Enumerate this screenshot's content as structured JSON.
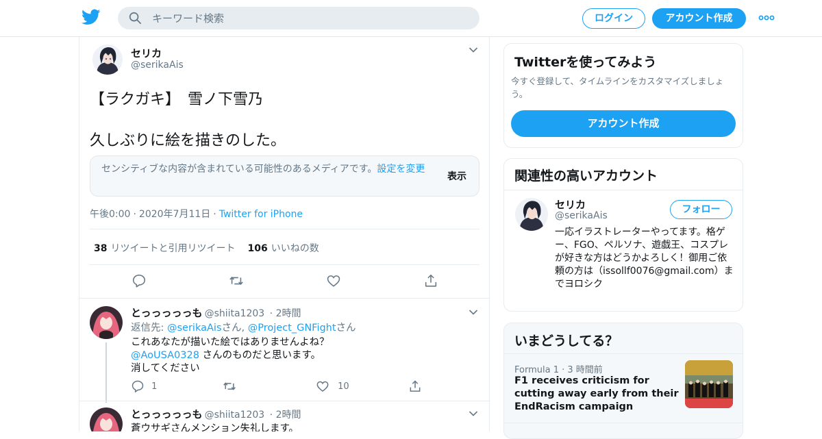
{
  "header": {
    "search_placeholder": "キーワード検索",
    "login_label": "ログイン",
    "signup_label": "アカウント作成",
    "brand_color": "#1da1f2"
  },
  "tweet": {
    "author_name": "セリカ",
    "author_handle": "@serikaAis",
    "text_line1": "【ラクガキ】　雪ノ下雪乃",
    "text_line2": "久しぶりに絵を描きのした。",
    "sensitive_message": "センシティブな内容が含まれている可能性のあるメディアです。",
    "sensitive_link": "設定を変更",
    "sensitive_show": "表示",
    "time": "午後0:00",
    "date": "2020年7月11日",
    "source": "Twitter for iPhone",
    "retweet_count": "38",
    "retweet_label": "リツイートと引用リツイート",
    "like_count": "106",
    "like_label": "いいねの数"
  },
  "replies": [
    {
      "name": "とっっっっっも",
      "handle": "@shiita1203",
      "time": "2時間",
      "reply_to_prefix": "返信先: ",
      "reply_to_1": "@serikaAis",
      "reply_to_sep": "さん, ",
      "reply_to_2": "@Project_GNFight",
      "reply_to_suffix": "さん",
      "line1": "これあなたが描いた絵ではありませんよね？",
      "mention": "@AoUSA0328",
      "line2_rest": " さんのものだと思います。",
      "line3": "消してください",
      "reply_count": "1",
      "like_count": "10"
    },
    {
      "name": "とっっっっっも",
      "handle": "@shiita1203",
      "time": "2時間",
      "line1": "蒼ウサギさんメンション失礼します。"
    }
  ],
  "sidebar": {
    "try_title": "Twitterを使ってみよう",
    "try_sub": "今すぐ登録して、タイムラインをカスタマイズしましょう。",
    "try_button": "アカウント作成",
    "related_title": "関連性の高いアカウント",
    "related_name": "セリカ",
    "related_handle": "@serikaAis",
    "follow_label": "フォロー",
    "related_bio": "一応イラストレーターやってます。格ゲー、FGO、ペルソナ、遊戯王、コスプレが好きな方はどうかよろしく！御用ご依頼の方は（issollf0076@gmail.com）までヨロシク",
    "trends_title": "いまどうしてる？",
    "trend_category": "Formula 1",
    "trend_time": "3 時間前",
    "trend_text": "F1 receives criticism for cutting away early from their EndRacism campaign"
  }
}
